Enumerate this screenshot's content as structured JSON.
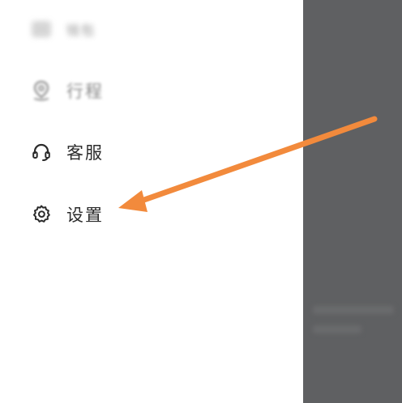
{
  "drawer": {
    "items": [
      {
        "label": "钱包",
        "icon": "wallet-icon"
      },
      {
        "label": "行程",
        "icon": "location-pin-icon"
      },
      {
        "label": "客服",
        "icon": "headset-icon"
      },
      {
        "label": "设置",
        "icon": "gear-icon"
      }
    ]
  },
  "overlay": {
    "color": "#5f6062"
  },
  "annotation": {
    "arrow_color": "#f28a3c",
    "points_to": "设置"
  }
}
